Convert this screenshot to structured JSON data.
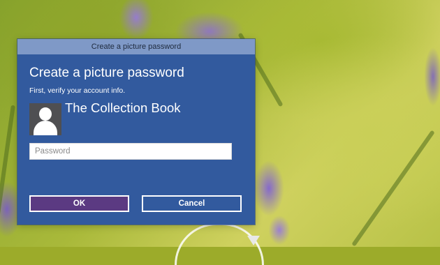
{
  "dialog": {
    "window_title": "Create a picture password",
    "heading": "Create a picture password",
    "subheading": "First, verify your account info.",
    "account_name": "The Collection Book",
    "avatar_icon": "user-icon",
    "password": {
      "placeholder": "Password",
      "value": ""
    },
    "ok_label": "OK",
    "cancel_label": "Cancel"
  },
  "colors": {
    "dialog_background": "#325a9e",
    "titlebar_background": "#7f99c7",
    "ok_button_background": "#5b3a82"
  },
  "background": {
    "gesture_icon": "circle-gesture-icon"
  }
}
